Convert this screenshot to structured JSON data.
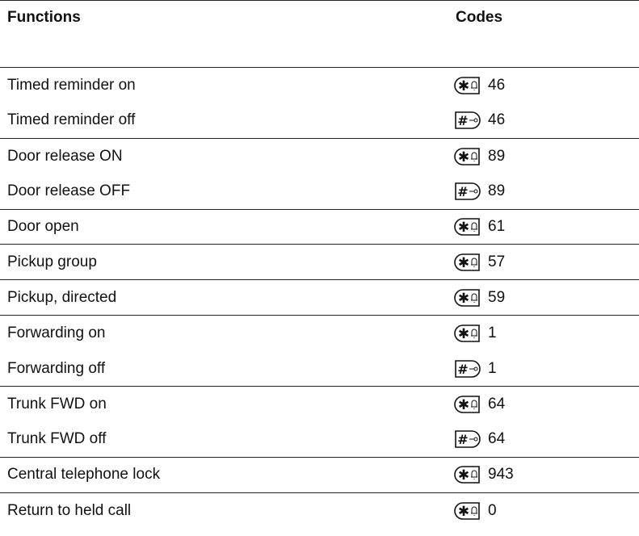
{
  "header": {
    "functions": "Functions",
    "codes": "Codes"
  },
  "rows": [
    {
      "function": "Timed reminder on",
      "key": "star-key-icon",
      "code": "46",
      "line": false
    },
    {
      "function": "Timed reminder off",
      "key": "hash-key-icon",
      "code": "46",
      "line": true
    },
    {
      "function": "Door release ON",
      "key": "star-key-icon",
      "code": "89",
      "line": false
    },
    {
      "function": "Door release OFF",
      "key": "hash-key-icon",
      "code": "89",
      "line": true
    },
    {
      "function": "Door open",
      "key": "star-key-icon",
      "code": "61",
      "line": true
    },
    {
      "function": "Pickup group",
      "key": "star-key-icon",
      "code": "57",
      "line": true
    },
    {
      "function": "Pickup, directed",
      "key": "star-key-icon",
      "code": "59",
      "line": true
    },
    {
      "function": "Forwarding on",
      "key": "star-key-icon",
      "code": "1",
      "line": false
    },
    {
      "function": "Forwarding off",
      "key": "hash-key-icon",
      "code": "1",
      "line": true
    },
    {
      "function": "Trunk FWD on",
      "key": "star-key-icon",
      "code": "64",
      "line": false
    },
    {
      "function": "Trunk FWD off",
      "key": "hash-key-icon",
      "code": "64",
      "line": true
    },
    {
      "function": "Central telephone lock",
      "key": "star-key-icon",
      "code": "943",
      "line": true
    },
    {
      "function": "Return to held call",
      "key": "star-key-icon",
      "code": "0",
      "line": false
    }
  ]
}
